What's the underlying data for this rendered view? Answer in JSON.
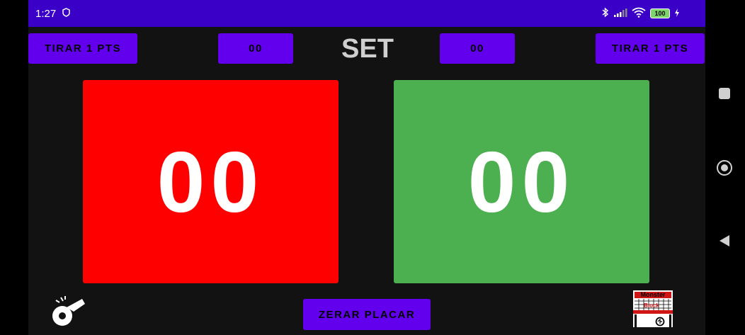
{
  "status_bar": {
    "time": "1:27",
    "battery": "100",
    "icons": [
      "shield-icon",
      "bluetooth-icon",
      "signal-icon",
      "wifi-icon",
      "battery-icon",
      "charging-icon"
    ]
  },
  "top_bar": {
    "left_remove_label": "TIRAR 1 PTS",
    "left_sets": "00",
    "set_label": "SET",
    "right_sets": "00",
    "right_remove_label": "TIRAR 1 PTS"
  },
  "scoreboard": {
    "left_score": "00",
    "right_score": "00",
    "left_color": "#ff0000",
    "right_color": "#4caf50"
  },
  "bottom_bar": {
    "reset_label": "ZERAR PLACAR",
    "whistle_icon": "whistle-icon",
    "logo_text_top": "Monster",
    "logo_text_bottom": "Block"
  },
  "colors": {
    "accent": "#6200ee",
    "status_bar": "#3b00c8",
    "background": "#121212"
  },
  "nav_bar": {
    "icons": [
      "recents-square-icon",
      "home-circle-icon",
      "back-triangle-icon"
    ]
  }
}
